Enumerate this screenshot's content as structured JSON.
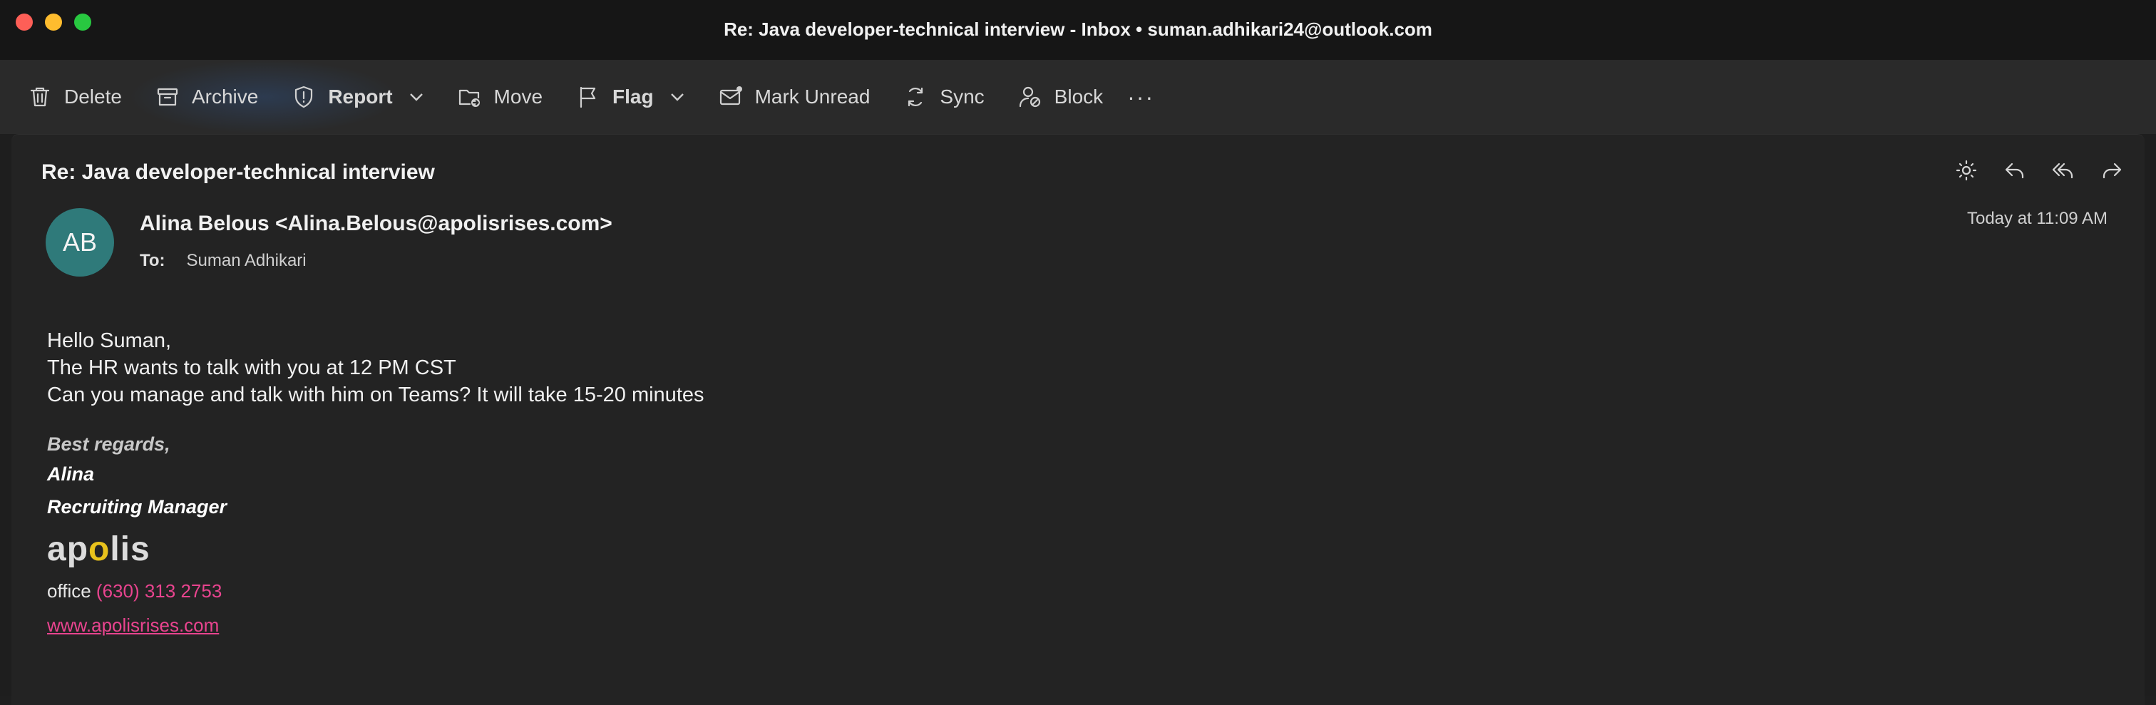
{
  "window": {
    "title": "Re: Java developer-technical interview - Inbox • suman.adhikari24@outlook.com"
  },
  "toolbar": {
    "delete_label": "Delete",
    "archive_label": "Archive",
    "report_label": "Report",
    "move_label": "Move",
    "flag_label": "Flag",
    "mark_unread_label": "Mark Unread",
    "sync_label": "Sync",
    "block_label": "Block",
    "more_label": "···"
  },
  "message": {
    "subject": "Re: Java developer-technical interview",
    "avatar_initials": "AB",
    "sender": "Alina Belous <Alina.Belous@apolisrises.com>",
    "to_label": "To:",
    "to_value": "Suman Adhikari",
    "timestamp": "Today at 11:09 AM",
    "body_lines": [
      "Hello Suman,",
      "The HR wants to talk with you at 12 PM CST",
      "Can you manage and talk with him on Teams? It will take 15-20 minutes"
    ],
    "signature": {
      "regards": "Best regards,",
      "name": "Alina",
      "title": "Recruiting Manager",
      "logo_part1": "ap",
      "logo_o": "o",
      "logo_part2": "lis",
      "office_label": "office",
      "phone": "(630) 313 2753",
      "website": "www.apolisrises.com"
    }
  },
  "colors": {
    "avatar": "#2f7a7a",
    "link": "#e9448f",
    "logo_accent": "#e8c21c"
  },
  "icons": [
    "trash-icon",
    "archive-icon",
    "shield-icon",
    "folder-move-icon",
    "flag-icon",
    "envelope-icon",
    "sync-icon",
    "block-user-icon",
    "sun-icon",
    "reply-icon",
    "reply-all-icon",
    "forward-icon"
  ]
}
